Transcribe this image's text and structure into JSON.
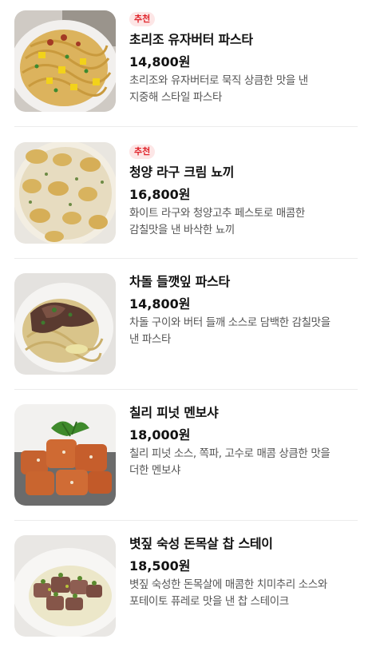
{
  "menu": {
    "items": [
      {
        "badge": "추천",
        "name": "초리조 유자버터 파스타",
        "price": "14,800원",
        "description_line1": "초리조와 유자버터로 묵직 상큼한 맛을 낸",
        "description_line2": "지중해 스타일 파스타",
        "image": "pasta-chorizo-yuzu-butter"
      },
      {
        "badge": "추천",
        "name": "청양 라구 크림 뇨끼",
        "price": "16,800원",
        "description_line1": "화이트 라구와 청양고추 페스토로 매콤한",
        "description_line2": "감칠맛을 낸 바삭한 뇨끼",
        "image": "gnocchi-ragu-cream"
      },
      {
        "name": "차돌 들깻잎 파스타",
        "price": "14,800원",
        "description_line1": "차돌 구이와 버터 들깨 소스로 담백한 감칠맛을",
        "description_line2": "낸 파스타",
        "image": "pasta-brisket-perilla"
      },
      {
        "name": "칠리 피넛 멘보샤",
        "price": "18,000원",
        "description_line1": "칠리 피넛 소스, 쪽파, 고수로 매콤 상큼한 맛을",
        "description_line2": "더한 멘보샤",
        "image": "chili-peanut-menbosha"
      },
      {
        "name": "볏짚 숙성 돈목살 찹 스테이",
        "price": "18,500원",
        "description_line1": "볏짚 숙성한 돈목살에 매콤한 치미추리 소스와",
        "description_line2": "포테이토 퓨레로 맛을 낸 찹 스테이크",
        "image": "pork-neck-chop-steak"
      }
    ]
  }
}
